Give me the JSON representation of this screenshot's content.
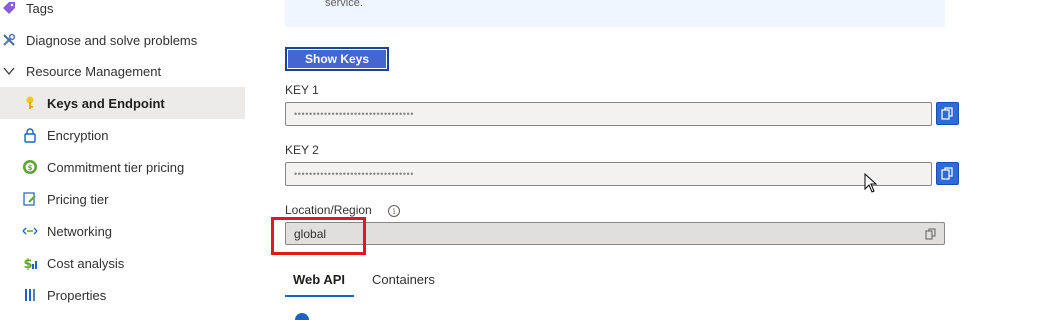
{
  "sidebar": {
    "items": [
      {
        "label": "Tags",
        "icon": "tag-icon"
      },
      {
        "label": "Diagnose and solve problems",
        "icon": "wrench-icon"
      },
      {
        "label": "Resource Management",
        "icon": "chevron-down-icon"
      },
      {
        "label": "Keys and Endpoint",
        "icon": "key-icon"
      },
      {
        "label": "Encryption",
        "icon": "lock-icon"
      },
      {
        "label": "Commitment tier pricing",
        "icon": "coin-icon"
      },
      {
        "label": "Pricing tier",
        "icon": "edit-doc-icon"
      },
      {
        "label": "Networking",
        "icon": "network-icon"
      },
      {
        "label": "Cost analysis",
        "icon": "dollar-icon"
      },
      {
        "label": "Properties",
        "icon": "properties-icon"
      }
    ]
  },
  "banner": {
    "text": "service."
  },
  "keys": {
    "show_label": "Show Keys",
    "key1_label": "KEY 1",
    "key1_value": "••••••••••••••••••••••••••••••••",
    "key2_label": "KEY 2",
    "key2_value": "••••••••••••••••••••••••••••••••"
  },
  "region": {
    "label": "Location/Region",
    "value": "global"
  },
  "tabs": [
    {
      "label": "Web API"
    },
    {
      "label": "Containers"
    }
  ],
  "colors": {
    "accent": "#2f6bd8",
    "highlight": "#e0181f",
    "selected_bg": "#edebe9"
  }
}
